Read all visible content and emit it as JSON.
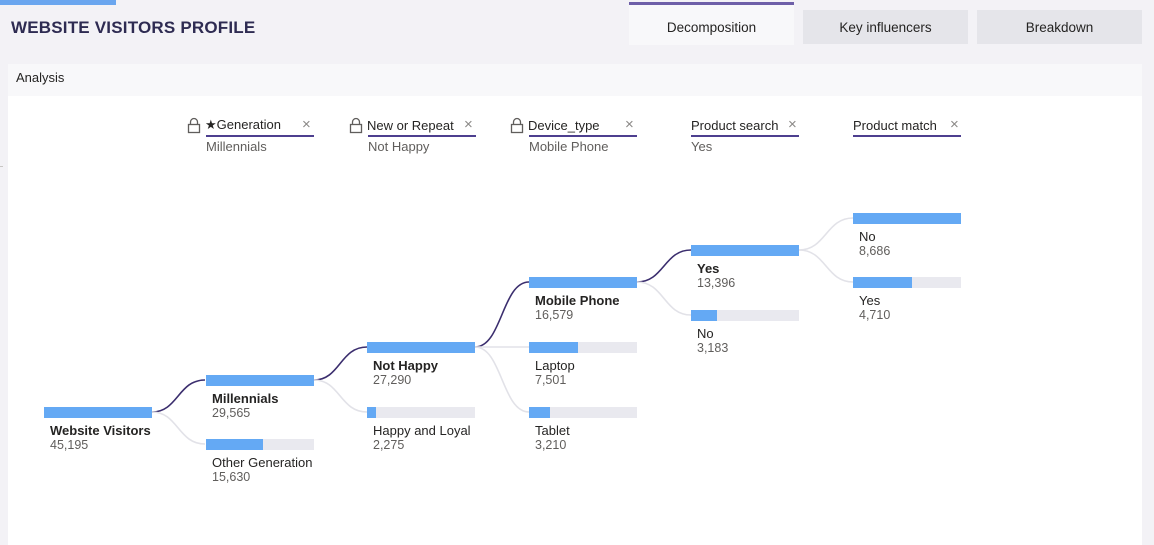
{
  "header": {
    "title": "WEBSITE VISITORS PROFILE"
  },
  "tabs": [
    {
      "label": "Decomposition",
      "active": true
    },
    {
      "label": "Key influencers",
      "active": false
    },
    {
      "label": "Breakdown",
      "active": false
    }
  ],
  "panel": {
    "title": "Analysis"
  },
  "levels": [
    {
      "label": "★Generation",
      "selected": "Millennials",
      "locked": true,
      "close": "×"
    },
    {
      "label": "New or Repeat",
      "selected": "Not Happy",
      "locked": true,
      "close": "×"
    },
    {
      "label": "Device_type",
      "selected": "Mobile Phone",
      "locked": true,
      "close": "×"
    },
    {
      "label": "Product search",
      "selected": "Yes",
      "locked": false,
      "close": "×"
    },
    {
      "label": "Product match",
      "selected": "",
      "locked": false,
      "close": "×"
    }
  ],
  "nodes": {
    "root": {
      "label": "Website Visitors",
      "value": "45,195",
      "fraction": 1.0
    },
    "millennials": {
      "label": "Millennials",
      "value": "29,565",
      "fraction": 1.0
    },
    "other_generation": {
      "label": "Other Generation",
      "value": "15,630",
      "fraction": 0.53
    },
    "not_happy": {
      "label": "Not Happy",
      "value": "27,290",
      "fraction": 1.0
    },
    "happy_loyal": {
      "label": "Happy and Loyal",
      "value": "2,275",
      "fraction": 0.083
    },
    "mobile_phone": {
      "label": "Mobile Phone",
      "value": "16,579",
      "fraction": 1.0
    },
    "laptop": {
      "label": "Laptop",
      "value": "7,501",
      "fraction": 0.452
    },
    "tablet": {
      "label": "Tablet",
      "value": "3,210",
      "fraction": 0.194
    },
    "search_yes": {
      "label": "Yes",
      "value": "13,396",
      "fraction": 1.0
    },
    "search_no": {
      "label": "No",
      "value": "3,183",
      "fraction": 0.238
    },
    "match_no": {
      "label": "No",
      "value": "8,686",
      "fraction": 1.0
    },
    "match_yes": {
      "label": "Yes",
      "value": "4,710",
      "fraction": 0.542
    }
  },
  "colors": {
    "bar_fill": "#64a9f4",
    "bar_track": "#e9e9ef",
    "selected_link": "#3b2e6e",
    "other_link": "#e2e2e8",
    "accent": "#6e5fa8"
  }
}
